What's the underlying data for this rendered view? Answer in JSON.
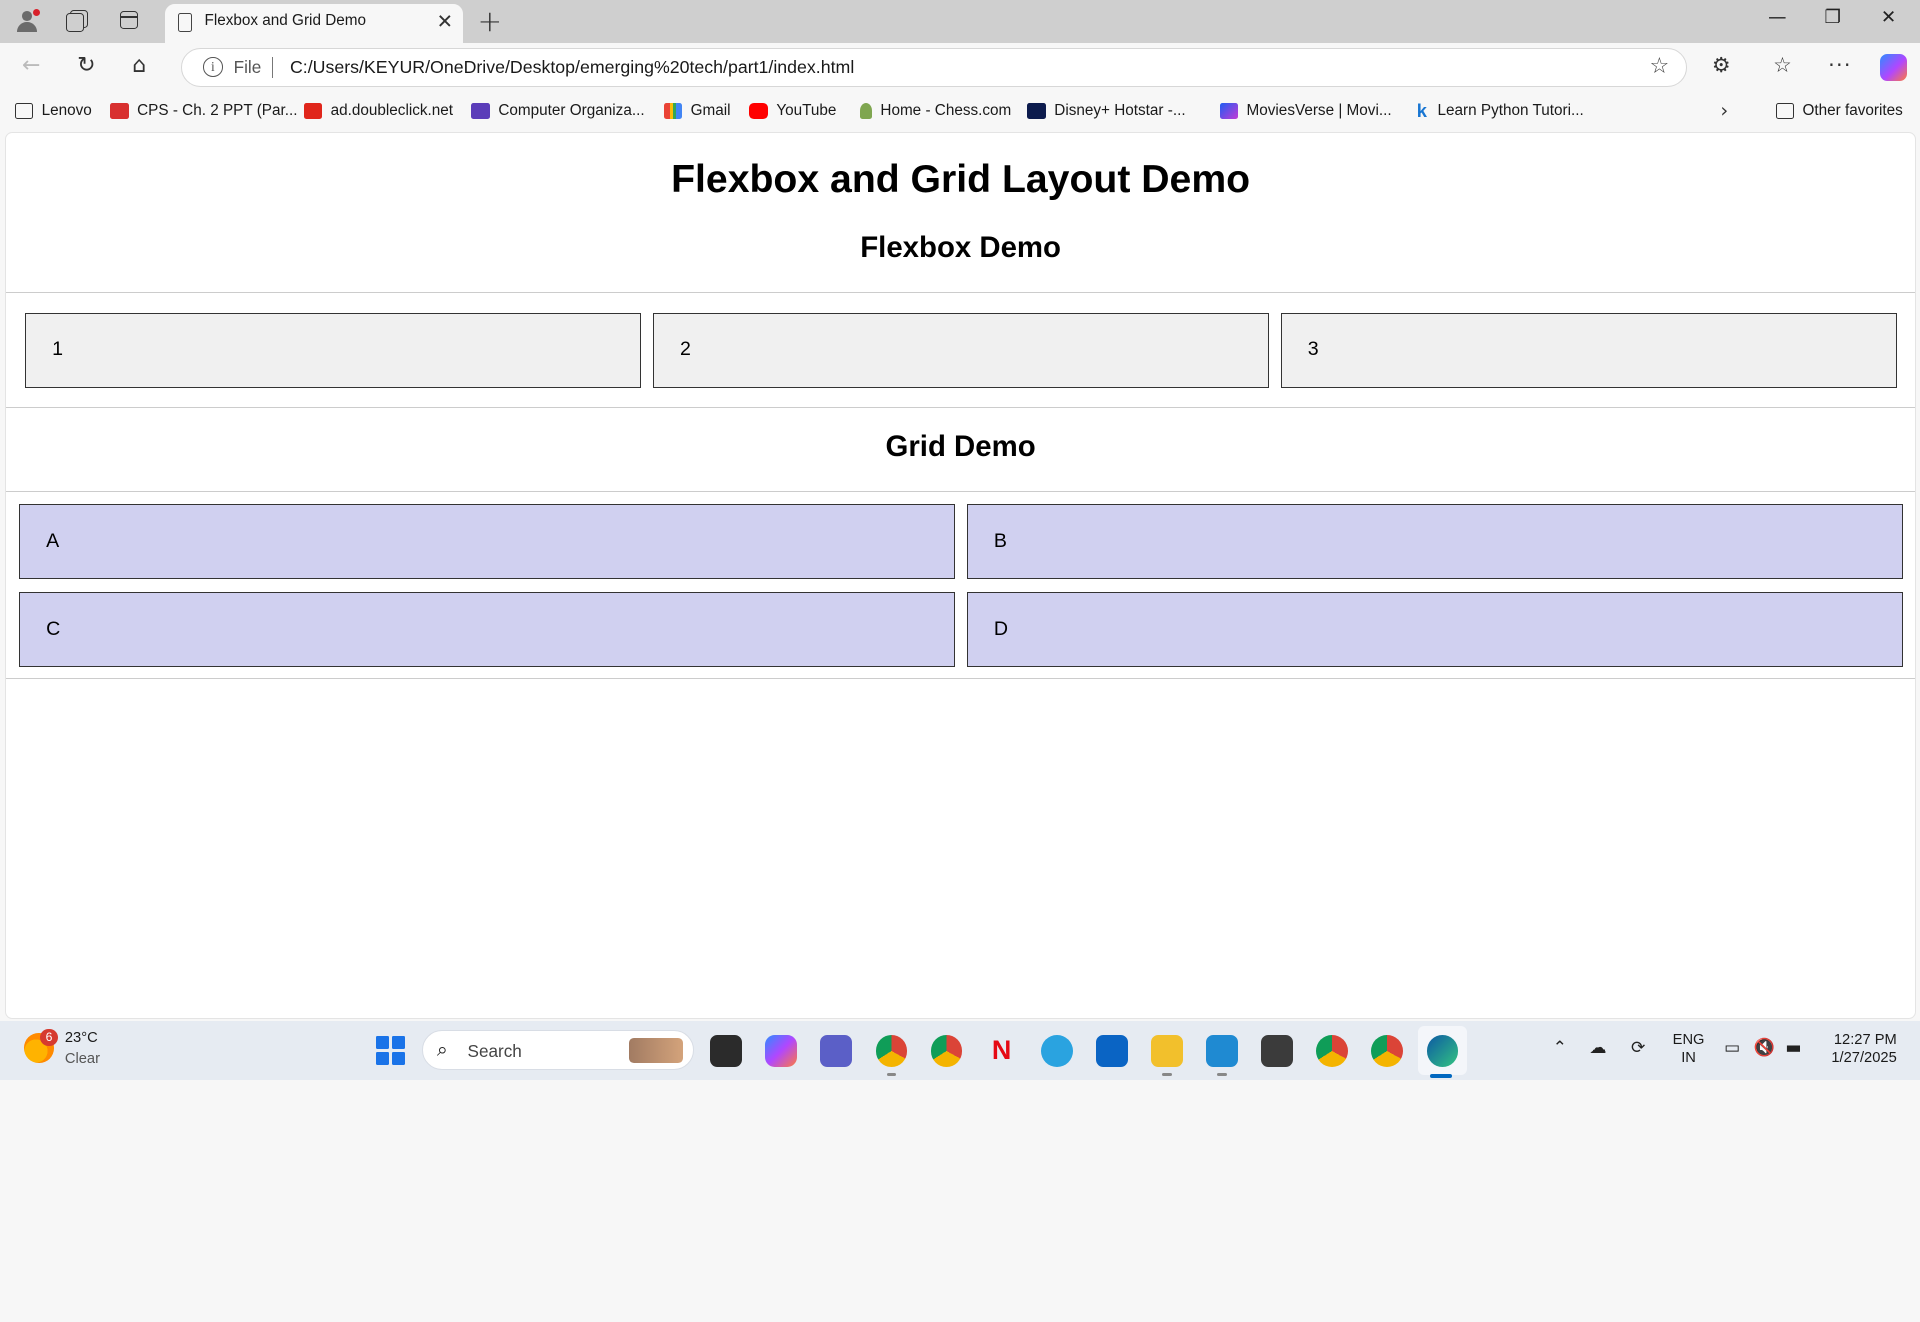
{
  "browser": {
    "tab_title": "Flexbox and Grid Demo",
    "new_tab_label": "+",
    "address": {
      "scheme_label": "File",
      "url": "C:/Users/KEYUR/OneDrive/Desktop/emerging%20tech/part1/index.html"
    },
    "favorites": [
      {
        "label": "Lenovo",
        "icon": "folder-icon"
      },
      {
        "label": "CPS - Ch. 2 PPT (Par...",
        "icon": "pdf-icon"
      },
      {
        "label": "ad.doubleclick.net",
        "icon": "doubleclick-icon"
      },
      {
        "label": "Computer Organiza...",
        "icon": "form-icon"
      },
      {
        "label": "Gmail",
        "icon": "gmail-icon"
      },
      {
        "label": "YouTube",
        "icon": "youtube-icon"
      },
      {
        "label": "Home - Chess.com",
        "icon": "chess-icon"
      },
      {
        "label": "Disney+ Hotstar -...",
        "icon": "hotstar-icon"
      },
      {
        "label": "MoviesVerse | Movi...",
        "icon": "moviesverse-icon"
      },
      {
        "label": "Learn Python Tutori...",
        "icon": "k-icon"
      }
    ],
    "other_favorites": "Other favorites"
  },
  "page": {
    "title": "Flexbox and Grid Layout Demo",
    "flex_heading": "Flexbox Demo",
    "flex_items": [
      "1",
      "2",
      "3"
    ],
    "grid_heading": "Grid Demo",
    "grid_items": [
      "A",
      "B",
      "C",
      "D"
    ],
    "colors": {
      "flex_item_bg": "#f0f0f0",
      "grid_item_bg": "#d0d0f0"
    }
  },
  "taskbar": {
    "weather_badge": "6",
    "temperature": "23°C",
    "condition": "Clear",
    "search_placeholder": "Search",
    "language_line1": "ENG",
    "language_line2": "IN",
    "time": "12:27 PM",
    "date": "1/27/2025"
  }
}
